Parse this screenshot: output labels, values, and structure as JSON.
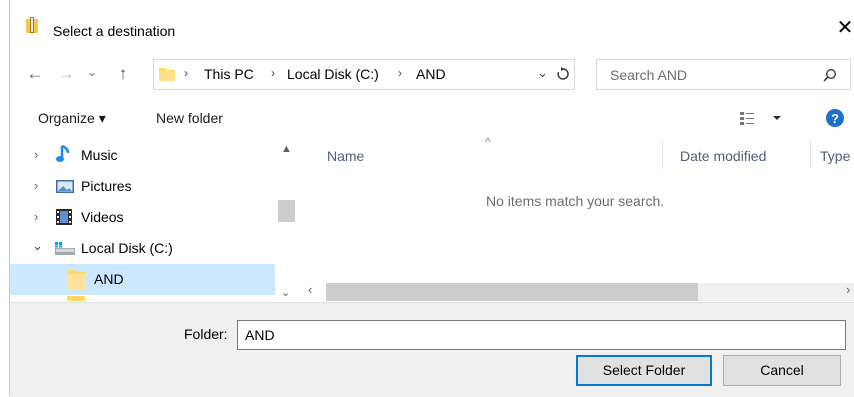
{
  "window": {
    "title": "Select a destination"
  },
  "nav": {
    "back_icon": "←",
    "forward_icon": "→",
    "recent_icon": "⌄",
    "up_icon": "↑"
  },
  "address": {
    "crumbs": [
      "This PC",
      "Local Disk (C:)",
      "AND"
    ],
    "separator": "›"
  },
  "search": {
    "placeholder": "Search AND"
  },
  "toolbar": {
    "organize_label": "Organize ▾",
    "new_folder_label": "New folder"
  },
  "sidebar": {
    "items": [
      {
        "label": "Music",
        "icon": "music-note-icon"
      },
      {
        "label": "Pictures",
        "icon": "pictures-icon"
      },
      {
        "label": "Videos",
        "icon": "videos-icon"
      },
      {
        "label": "Local Disk (C:)",
        "icon": "drive-icon"
      },
      {
        "label": "AND",
        "icon": "folder-icon",
        "selected": true
      }
    ]
  },
  "content": {
    "columns": [
      "Name",
      "Date modified",
      "Type"
    ],
    "empty_message": "No items match your search."
  },
  "footer": {
    "folder_label": "Folder:",
    "folder_value": "AND",
    "select_button": "Select Folder",
    "cancel_button": "Cancel"
  },
  "colors": {
    "selection": "#cce8ff",
    "accent": "#0078d7",
    "help": "#1c6fd1",
    "folder": "#ffd867"
  }
}
